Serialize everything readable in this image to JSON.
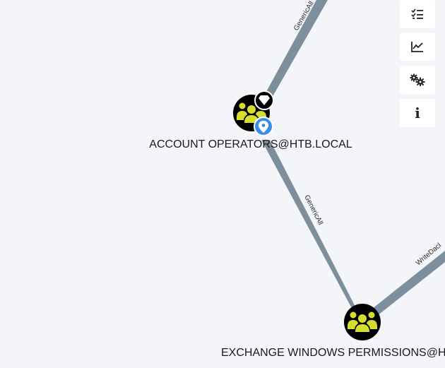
{
  "graph": {
    "nodes": {
      "account_operators": {
        "label": "ACCOUNT OPERATORS@HTB.LOCAL",
        "type": "group",
        "badges": [
          "high-value-diamond-icon",
          "owned-pin-icon"
        ]
      },
      "exchange_windows_permissions": {
        "label": "EXCHANGE WINDOWS PERMISSIONS@H",
        "type": "group"
      }
    },
    "edges": {
      "top_to_account_operators": {
        "label": "GenericAll"
      },
      "account_operators_to_exchange": {
        "label": "GenericAll"
      },
      "exchange_to_right": {
        "label": "WriteDacl"
      }
    }
  },
  "toolbar": {
    "items": [
      {
        "name": "checklist-icon",
        "title": "list"
      },
      {
        "name": "line-chart-icon",
        "title": "chart"
      },
      {
        "name": "gears-icon",
        "title": "settings"
      },
      {
        "name": "info-icon",
        "title": "info",
        "glyph": "i"
      }
    ]
  },
  "colors": {
    "background": "#f3f5f9",
    "edge": "#7d8f9c",
    "node_fill": "#000000",
    "node_icon": "#d6de2b",
    "pin": "#3b8ee8"
  }
}
